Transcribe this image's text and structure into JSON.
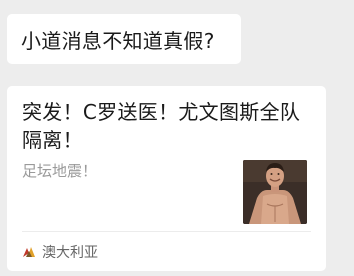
{
  "message": {
    "text": "小道消息不知道真假?"
  },
  "link_card": {
    "title": "突发！C罗送医！尤文图斯全队隔离！",
    "description": "足坛地震！",
    "thumbnail_icon": "athlete-photo",
    "source_icon": "source-logo-icon",
    "source_name": "澳大利亚"
  }
}
